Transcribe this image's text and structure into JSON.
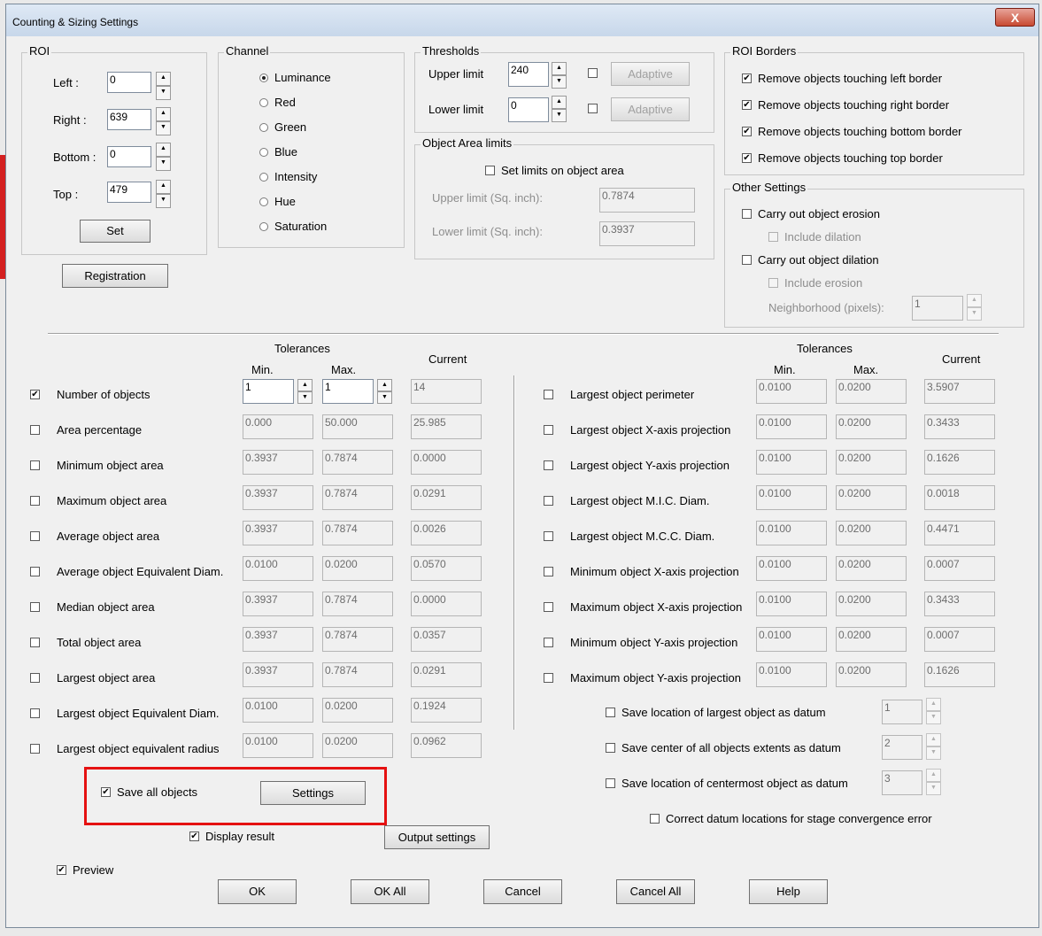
{
  "window": {
    "title": "Counting & Sizing Settings",
    "close_glyph": "X"
  },
  "roi": {
    "group_label": "ROI",
    "left": {
      "label": "Left      :",
      "value": "0"
    },
    "right": {
      "label": "Right     :",
      "value": "639"
    },
    "bottom": {
      "label": "Bottom :",
      "value": "0"
    },
    "top": {
      "label": "Top      :",
      "value": "479"
    },
    "set_button": "Set",
    "registration_button": "Registration"
  },
  "channel": {
    "group_label": "Channel",
    "options": [
      "Luminance",
      "Red",
      "Green",
      "Blue",
      "Intensity",
      "Hue",
      "Saturation"
    ],
    "selected": "Luminance"
  },
  "thresholds": {
    "group_label": "Thresholds",
    "upper": {
      "label": "Upper limit",
      "value": "240",
      "adaptive": "Adaptive",
      "adaptive_checked": false
    },
    "lower": {
      "label": "Lower limit",
      "value": "0",
      "adaptive": "Adaptive",
      "adaptive_checked": false
    }
  },
  "object_area_limits": {
    "group_label": "Object Area limits",
    "set_limits_label": "Set limits on object area",
    "set_limits_checked": false,
    "upper": {
      "label": "Upper limit (Sq. inch):",
      "value": "0.7874"
    },
    "lower": {
      "label": "Lower limit (Sq. inch):",
      "value": "0.3937"
    }
  },
  "roi_borders": {
    "group_label": "ROI Borders",
    "items": [
      {
        "label": "Remove objects touching left border",
        "checked": true
      },
      {
        "label": "Remove objects touching right border",
        "checked": true
      },
      {
        "label": "Remove objects touching bottom border",
        "checked": true
      },
      {
        "label": "Remove objects touching top border",
        "checked": true
      }
    ]
  },
  "other_settings": {
    "group_label": "Other Settings",
    "erosion": {
      "label": "Carry out object erosion",
      "checked": false
    },
    "include_dilation": {
      "label": "Include dilation",
      "checked": false
    },
    "dilation": {
      "label": "Carry out object dilation",
      "checked": false
    },
    "include_erosion": {
      "label": "Include erosion",
      "checked": false
    },
    "neighborhood": {
      "label": "Neighborhood (pixels):",
      "value": "1"
    }
  },
  "left_table": {
    "tolerances_label": "Tolerances",
    "min_label": "Min.",
    "max_label": "Max.",
    "current_label": "Current",
    "rows": [
      {
        "label": "Number of objects",
        "checked": true,
        "min": "1",
        "max": "1",
        "current": "14"
      },
      {
        "label": "Area percentage",
        "checked": false,
        "min": "0.000",
        "max": "50.000",
        "current": "25.985"
      },
      {
        "label": "Minimum object area",
        "checked": false,
        "min": "0.3937",
        "max": "0.7874",
        "current": "0.0000"
      },
      {
        "label": "Maximum object area",
        "checked": false,
        "min": "0.3937",
        "max": "0.7874",
        "current": "0.0291"
      },
      {
        "label": "Average object area",
        "checked": false,
        "min": "0.3937",
        "max": "0.7874",
        "current": "0.0026"
      },
      {
        "label": "Average object Equivalent Diam.",
        "checked": false,
        "min": "0.0100",
        "max": "0.0200",
        "current": "0.0570"
      },
      {
        "label": "Median object area",
        "checked": false,
        "min": "0.3937",
        "max": "0.7874",
        "current": "0.0000"
      },
      {
        "label": "Total object area",
        "checked": false,
        "min": "0.3937",
        "max": "0.7874",
        "current": "0.0357"
      },
      {
        "label": "Largest object area",
        "checked": false,
        "min": "0.3937",
        "max": "0.7874",
        "current": "0.0291"
      },
      {
        "label": "Largest object Equivalent Diam.",
        "checked": false,
        "min": "0.0100",
        "max": "0.0200",
        "current": "0.1924"
      },
      {
        "label": "Largest object equivalent radius",
        "checked": false,
        "min": "0.0100",
        "max": "0.0200",
        "current": "0.0962"
      }
    ]
  },
  "right_table": {
    "tolerances_label": "Tolerances",
    "min_label": "Min.",
    "max_label": "Max.",
    "current_label": "Current",
    "rows": [
      {
        "label": "Largest object perimeter",
        "checked": false,
        "min": "0.0100",
        "max": "0.0200",
        "current": "3.5907"
      },
      {
        "label": "Largest object X-axis projection",
        "checked": false,
        "min": "0.0100",
        "max": "0.0200",
        "current": "0.3433"
      },
      {
        "label": "Largest object Y-axis projection",
        "checked": false,
        "min": "0.0100",
        "max": "0.0200",
        "current": "0.1626"
      },
      {
        "label": "Largest object M.I.C. Diam.",
        "checked": false,
        "min": "0.0100",
        "max": "0.0200",
        "current": "0.0018"
      },
      {
        "label": "Largest object M.C.C. Diam.",
        "checked": false,
        "min": "0.0100",
        "max": "0.0200",
        "current": "0.4471"
      },
      {
        "label": "Minimum object X-axis projection",
        "checked": false,
        "min": "0.0100",
        "max": "0.0200",
        "current": "0.0007"
      },
      {
        "label": "Maximum object X-axis projection",
        "checked": false,
        "min": "0.0100",
        "max": "0.0200",
        "current": "0.3433"
      },
      {
        "label": "Minimum object Y-axis projection",
        "checked": false,
        "min": "0.0100",
        "max": "0.0200",
        "current": "0.0007"
      },
      {
        "label": "Maximum object Y-axis projection",
        "checked": false,
        "min": "0.0100",
        "max": "0.0200",
        "current": "0.1626"
      }
    ]
  },
  "datum": [
    {
      "label": "Save location of largest object as datum",
      "checked": false,
      "value": "1"
    },
    {
      "label": "Save center of all objects extents as datum",
      "checked": false,
      "value": "2"
    },
    {
      "label": "Save location of centermost object as datum",
      "checked": false,
      "value": "3"
    }
  ],
  "correct_datum": {
    "label": "Correct datum locations for stage convergence error",
    "checked": false
  },
  "save_all_objects": {
    "label": "Save all objects",
    "checked": true,
    "settings_button": "Settings"
  },
  "display_result": {
    "label": "Display result",
    "checked": true
  },
  "output_settings_button": "Output settings",
  "preview": {
    "label": "Preview",
    "checked": true
  },
  "footer_buttons": {
    "ok": "OK",
    "ok_all": "OK All",
    "cancel": "Cancel",
    "cancel_all": "Cancel All",
    "help": "Help"
  },
  "check_glyph": "✔",
  "spin_up_glyph": "▲",
  "spin_down_glyph": "▼",
  "colors": {
    "highlight": "#e51111",
    "dialog_bg": "#f0f0f0"
  }
}
